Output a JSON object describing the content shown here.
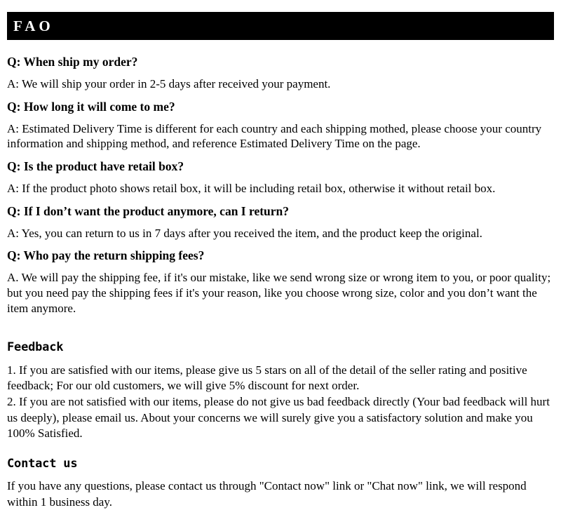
{
  "header": {
    "title": "FAO"
  },
  "faq": {
    "items": [
      {
        "question": "Q: When ship my order?",
        "answer": "A: We will ship your order in 2-5 days after received your payment."
      },
      {
        "question": "Q: How long it will come to me?",
        "answer": "A: Estimated Delivery Time is different for each country and each shipping mothed, please choose your country information and shipping method, and reference Estimated Delivery Time on the page."
      },
      {
        "question": "Q: Is the product have retail box?",
        "answer": "A: If  the product photo shows retail box, it will be including retail box, otherwise it without retail box."
      },
      {
        "question": "Q: If I don’t want the product anymore, can I return?",
        "answer": "A: Yes, you can return to us in 7 days after you received the item, and the product keep the original."
      },
      {
        "question": "Q: Who pay the return shipping fees?",
        "answer": "A.  We will pay the shipping fee, if  it's our mistake, like we send wrong size or wrong item to you, or poor quality; but you need pay the shipping fees if  it's your reason, like you choose wrong size, color and you don’t want the item anymore."
      }
    ]
  },
  "feedback": {
    "heading": "Feedback",
    "paragraph_1": "1.  If you are satisfied with our items, please give us 5 stars on all of the detail of the seller rating and positive feedback; For our old customers, we will give 5% discount for next order.",
    "paragraph_2": "2.  If you are not satisfied with our items, please do not give us bad feedback directly (Your bad feedback will hurt us deeply), please email us. About your concerns we will surely give you a satisfactory solution and make you 100% Satisfied."
  },
  "contact": {
    "heading": "Contact us",
    "paragraph": "If you have any questions, please contact us through \"Contact now\" link or \"Chat now\" link, we will respond within 1 business day."
  }
}
